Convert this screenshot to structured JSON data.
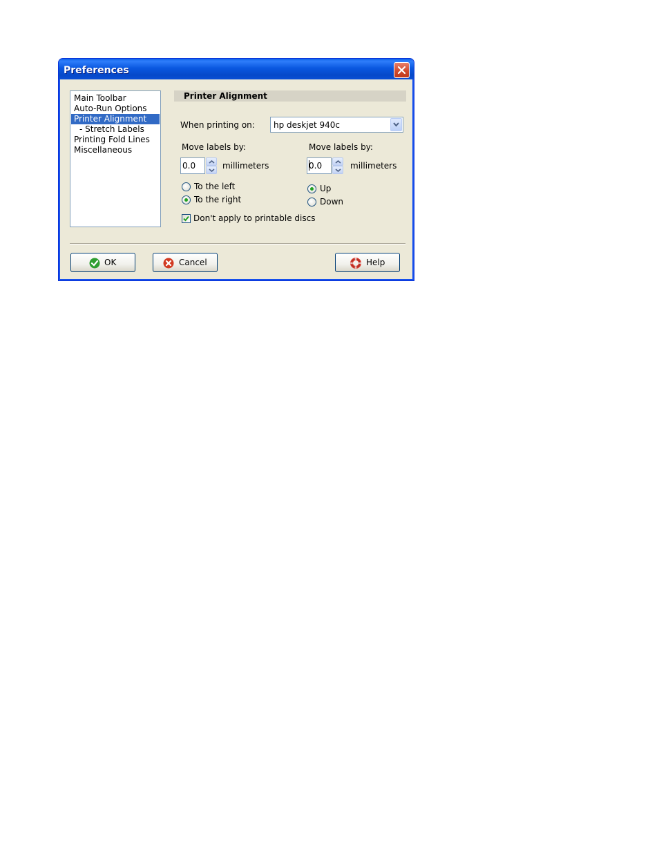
{
  "window": {
    "title": "Preferences"
  },
  "nav": {
    "items": [
      {
        "label": "Main Toolbar"
      },
      {
        "label": "Auto-Run Options"
      },
      {
        "label": "Printer Alignment"
      },
      {
        "label": "- Stretch Labels"
      },
      {
        "label": "Printing Fold Lines"
      },
      {
        "label": "Miscellaneous"
      }
    ],
    "selected": "Printer Alignment"
  },
  "section": {
    "title": "Printer Alignment"
  },
  "printer": {
    "label": "When printing on:",
    "selected": "hp deskjet 940c"
  },
  "horizontal": {
    "label": "Move labels by:",
    "value": "0.0",
    "unit": "millimeters",
    "options": [
      "To the left",
      "To the right"
    ],
    "selected": "To the right"
  },
  "vertical": {
    "label": "Move labels by:",
    "value": "0.0",
    "unit": "millimeters",
    "options": [
      "Up",
      "Down"
    ],
    "selected": "Up"
  },
  "discs": {
    "label": "Don't apply to printable discs",
    "checked": true
  },
  "buttons": {
    "ok": "OK",
    "cancel": "Cancel",
    "help": "Help"
  },
  "colors": {
    "titlebar": "#0a58e0",
    "selection": "#316ac5",
    "dialog_bg": "#ece9d8"
  }
}
